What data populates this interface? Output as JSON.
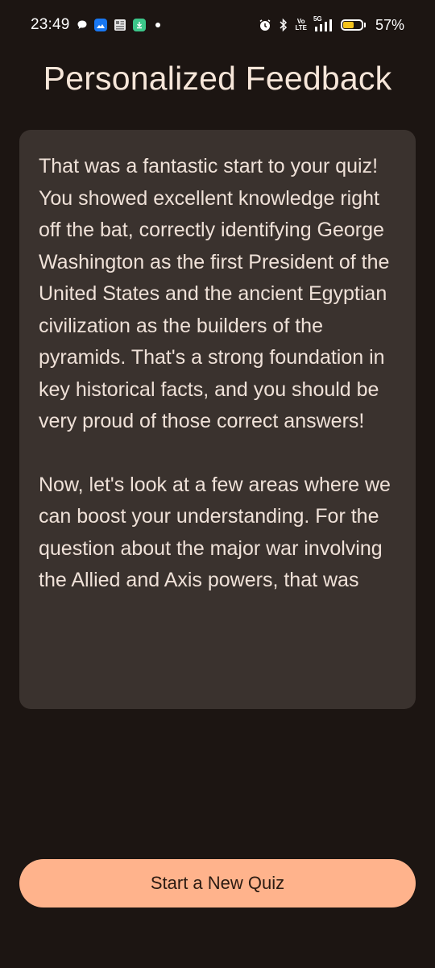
{
  "status_bar": {
    "time": "23:49",
    "network_label_top": "Vo",
    "network_label_bottom": "LTE",
    "network_type": "5G",
    "battery_percent_text": "57%",
    "battery_level": 0.57
  },
  "header": {
    "title": "Personalized Feedback"
  },
  "feedback": {
    "paragraphs": [
      "That was a fantastic start to your quiz! You showed excellent knowledge right off the bat, correctly identifying George Washington as the first President of the United States and the ancient Egyptian civilization as the builders of the pyramids. That's a strong foundation in key historical facts, and you should be very proud of those correct answers!",
      "Now, let's look at a few areas where we can boost your understanding. For the question about the major war involving the Allied and Axis powers, that was"
    ]
  },
  "actions": {
    "new_quiz_label": "Start a New Quiz"
  },
  "colors": {
    "background": "#1c1512",
    "card": "#3a322e",
    "accent": "#ffb38c"
  }
}
